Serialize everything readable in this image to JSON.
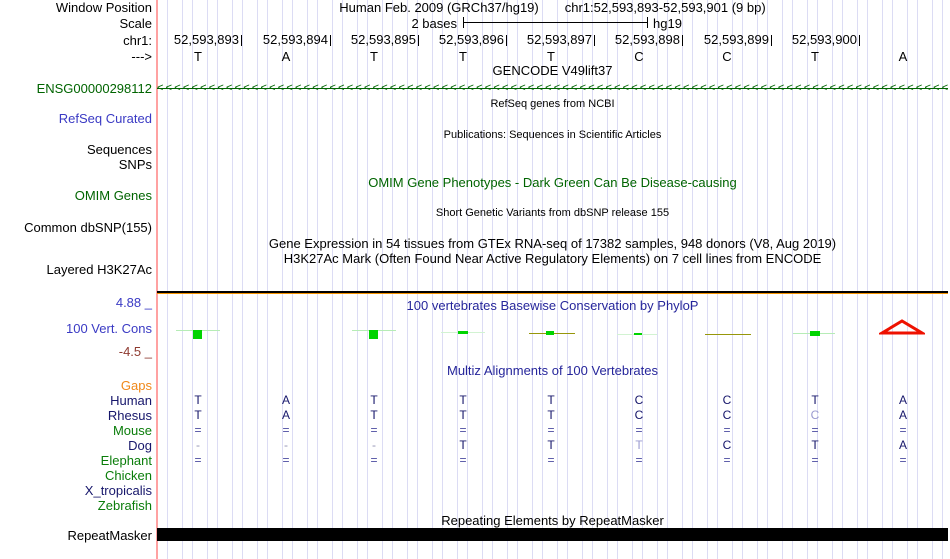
{
  "header": {
    "left_labels": {
      "window_position": "Window Position",
      "scale": "Scale",
      "chrom": "chr1:",
      "strand": "--->"
    },
    "assembly": "Human Feb. 2009 (GRCh37/hg19)",
    "position": "chr1:52,593,893-52,593,901 (9 bp)",
    "scale_bar": {
      "label": "2 bases",
      "genome": "hg19"
    },
    "ruler_positions": [
      "52,593,893",
      "52,593,894",
      "52,593,895",
      "52,593,896",
      "52,593,897",
      "52,593,898",
      "52,593,899",
      "52,593,900"
    ],
    "sequence": [
      "T",
      "A",
      "T",
      "T",
      "T",
      "C",
      "C",
      "T",
      "A"
    ]
  },
  "tracks": {
    "gencode": {
      "title": "GENCODE V49lift37",
      "gene_id": "ENSG00000298112",
      "arrows": "<<<<<<<<<<<<<<<<<<<<<<<<<<<<<<<<<<<<<<<<<<<<<<<<<<<<<<<<<<<<<<<<<<<<<<<<<<<<<<<<<<<<<<<<<<<<<<<<<<<<"
    },
    "refseq": {
      "title": "RefSeq genes from NCBI",
      "label": "RefSeq Curated"
    },
    "publications": {
      "title": "Publications: Sequences in Scientific Articles",
      "label_sequences": "Sequences",
      "label_snps": "SNPs"
    },
    "omim": {
      "title": "OMIM Gene Phenotypes - Dark Green Can Be Disease-causing",
      "label": "OMIM Genes"
    },
    "dbsnp": {
      "title": "Short Genetic Variants from dbSNP release 155",
      "label": "Common dbSNP(155)"
    },
    "gtex": {
      "title": "Gene Expression in 54 tissues from GTEx RNA-seq of 17382 samples, 948 donors (V8, Aug 2019)"
    },
    "h3k27ac": {
      "title": "H3K27Ac Mark (Often Found Near Active Regulatory Elements) on 7 cell lines from ENCODE",
      "label": "Layered H3K27Ac"
    },
    "conservation": {
      "title": "100 vertebrates Basewise Conservation by PhyloP",
      "label": "100 Vert. Cons",
      "max": "4.88 _",
      "min": "-4.5 _",
      "marks": [
        {
          "base": "T",
          "signal": "positive-strong"
        },
        {
          "base": "A",
          "signal": "none"
        },
        {
          "base": "T",
          "signal": "positive-strong"
        },
        {
          "base": "T",
          "signal": "positive-weak"
        },
        {
          "base": "T",
          "signal": "mixed"
        },
        {
          "base": "C",
          "signal": "positive-weak"
        },
        {
          "base": "C",
          "signal": "mixed"
        },
        {
          "base": "T",
          "signal": "positive-weak"
        },
        {
          "base": "A",
          "signal": "negative"
        }
      ]
    },
    "multiz": {
      "title": "Multiz Alignments of 100 Vertebrates",
      "species": [
        {
          "name": "Gaps",
          "tone": "orange"
        },
        {
          "name": "Human",
          "tone": "navy"
        },
        {
          "name": "Rhesus",
          "tone": "navy"
        },
        {
          "name": "Mouse",
          "tone": "green"
        },
        {
          "name": "Dog",
          "tone": "navy"
        },
        {
          "name": "Elephant",
          "tone": "green"
        },
        {
          "name": "Chicken",
          "tone": "green"
        },
        {
          "name": "X_tropicalis",
          "tone": "navy"
        },
        {
          "name": "Zebrafish",
          "tone": "green"
        }
      ],
      "grid": [
        [
          {
            "ch": "T",
            "tone": "base"
          },
          {
            "ch": "A",
            "tone": "base"
          },
          {
            "ch": "T",
            "tone": "base"
          },
          {
            "ch": "T",
            "tone": "base"
          },
          {
            "ch": "T",
            "tone": "base"
          },
          {
            "ch": "C",
            "tone": "base"
          },
          {
            "ch": "C",
            "tone": "base"
          },
          {
            "ch": "T",
            "tone": "base"
          },
          {
            "ch": "A",
            "tone": "base"
          }
        ],
        [
          {
            "ch": "T",
            "tone": "base"
          },
          {
            "ch": "A",
            "tone": "base"
          },
          {
            "ch": "T",
            "tone": "base"
          },
          {
            "ch": "T",
            "tone": "base"
          },
          {
            "ch": "T",
            "tone": "base"
          },
          {
            "ch": "C",
            "tone": "base"
          },
          {
            "ch": "C",
            "tone": "base"
          },
          {
            "ch": "C",
            "tone": "faint"
          },
          {
            "ch": "A",
            "tone": "base"
          }
        ],
        [
          {
            "ch": "=",
            "tone": "eq"
          },
          {
            "ch": "=",
            "tone": "eq"
          },
          {
            "ch": "=",
            "tone": "eq"
          },
          {
            "ch": "=",
            "tone": "eq"
          },
          {
            "ch": "=",
            "tone": "eq"
          },
          {
            "ch": "=",
            "tone": "eq"
          },
          {
            "ch": "=",
            "tone": "eq"
          },
          {
            "ch": "=",
            "tone": "eq"
          },
          {
            "ch": "=",
            "tone": "eq"
          }
        ],
        [
          {
            "ch": "-",
            "tone": "dash"
          },
          {
            "ch": "-",
            "tone": "dash"
          },
          {
            "ch": "-",
            "tone": "dash"
          },
          {
            "ch": "T",
            "tone": "base"
          },
          {
            "ch": "T",
            "tone": "base"
          },
          {
            "ch": "T",
            "tone": "faint"
          },
          {
            "ch": "C",
            "tone": "base"
          },
          {
            "ch": "T",
            "tone": "base"
          },
          {
            "ch": "A",
            "tone": "base"
          }
        ],
        [
          {
            "ch": "=",
            "tone": "eq"
          },
          {
            "ch": "=",
            "tone": "eq"
          },
          {
            "ch": "=",
            "tone": "eq"
          },
          {
            "ch": "=",
            "tone": "eq"
          },
          {
            "ch": "=",
            "tone": "eq"
          },
          {
            "ch": "=",
            "tone": "eq"
          },
          {
            "ch": "=",
            "tone": "eq"
          },
          {
            "ch": "=",
            "tone": "eq"
          },
          {
            "ch": "=",
            "tone": "eq"
          }
        ]
      ]
    },
    "repeatmasker": {
      "title": "Repeating Elements by RepeatMasker",
      "label": "RepeatMasker"
    }
  },
  "colors": {
    "guide_line": "#dcdcf4",
    "cursor_line": "#ffa2a2",
    "gene_green": "#006400",
    "label_blue": "#3a3ac4",
    "title_blue": "#26269b",
    "cons_positive": "#00d400",
    "cons_olive": "#97970a",
    "cons_negative": "#ee1100",
    "h3k27ac_orange": "#f59300",
    "repeat_black": "#000000"
  }
}
